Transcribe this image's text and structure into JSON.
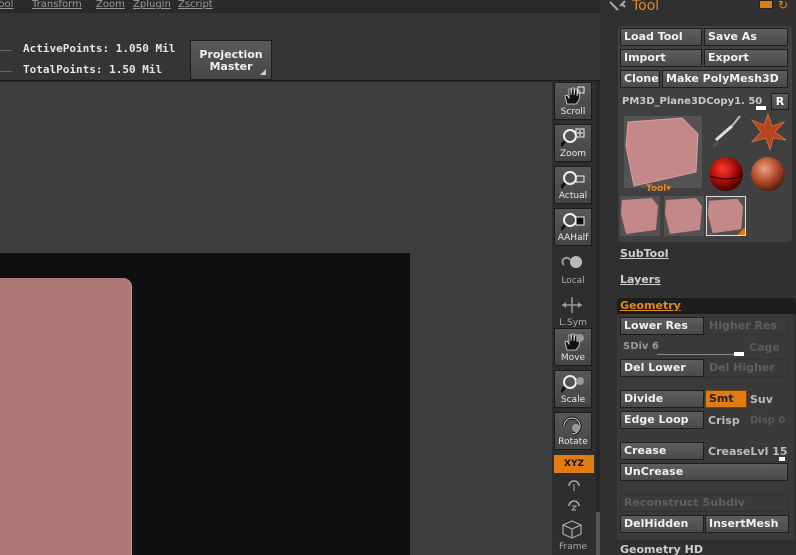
{
  "menu": [
    "Tool",
    "Transform",
    "Zoom",
    "Zplugin",
    "Zscript"
  ],
  "stats": {
    "active_points": "ActivePoints: 1.050  Mil",
    "total_points": "TotalPoints: 1.50  Mil"
  },
  "projection_button": {
    "line1": "Projection",
    "line2": "Master"
  },
  "right_toolbar": {
    "scroll": "Scroll",
    "zoom": "Zoom",
    "actual": "Actual",
    "aahalf": "AAHalf",
    "local": "Local",
    "lsym": "L.Sym",
    "move": "Move",
    "scale": "Scale",
    "rotate": "Rotate",
    "xyz": "XYZ",
    "frame": "Frame"
  },
  "palette": {
    "title": "Tool",
    "load_tool": "Load Tool",
    "save_as": "Save As",
    "import": "Import",
    "export": "Export",
    "clone": "Clone",
    "make_polymesh": "Make PolyMesh3D",
    "mesh_name": "PM3D_Plane3DCopy1. 50",
    "r": "R",
    "tool_label": "Tool▾",
    "subtool": "SubTool",
    "layers": "Layers",
    "geometry": {
      "title": "Geometry",
      "lower_res": "Lower Res",
      "higher_res": "Higher Res",
      "sdiv": "SDiv 6",
      "cage": "Cage",
      "del_lower": "Del Lower",
      "del_higher": "Del Higher",
      "divide": "Divide",
      "smt": "Smt",
      "suv": "Suv",
      "edge_loop": "Edge Loop",
      "crisp": "Crisp",
      "disp": "Disp 0",
      "crease": "Crease",
      "crease_lvl": "CreaseLvl 15",
      "uncrease": "UnCrease",
      "reconstruct": "Reconstruct Subdiv",
      "del_hidden": "DelHidden",
      "insert_mesh": "InsertMesh"
    },
    "geometry_hd": "Geometry HD"
  }
}
